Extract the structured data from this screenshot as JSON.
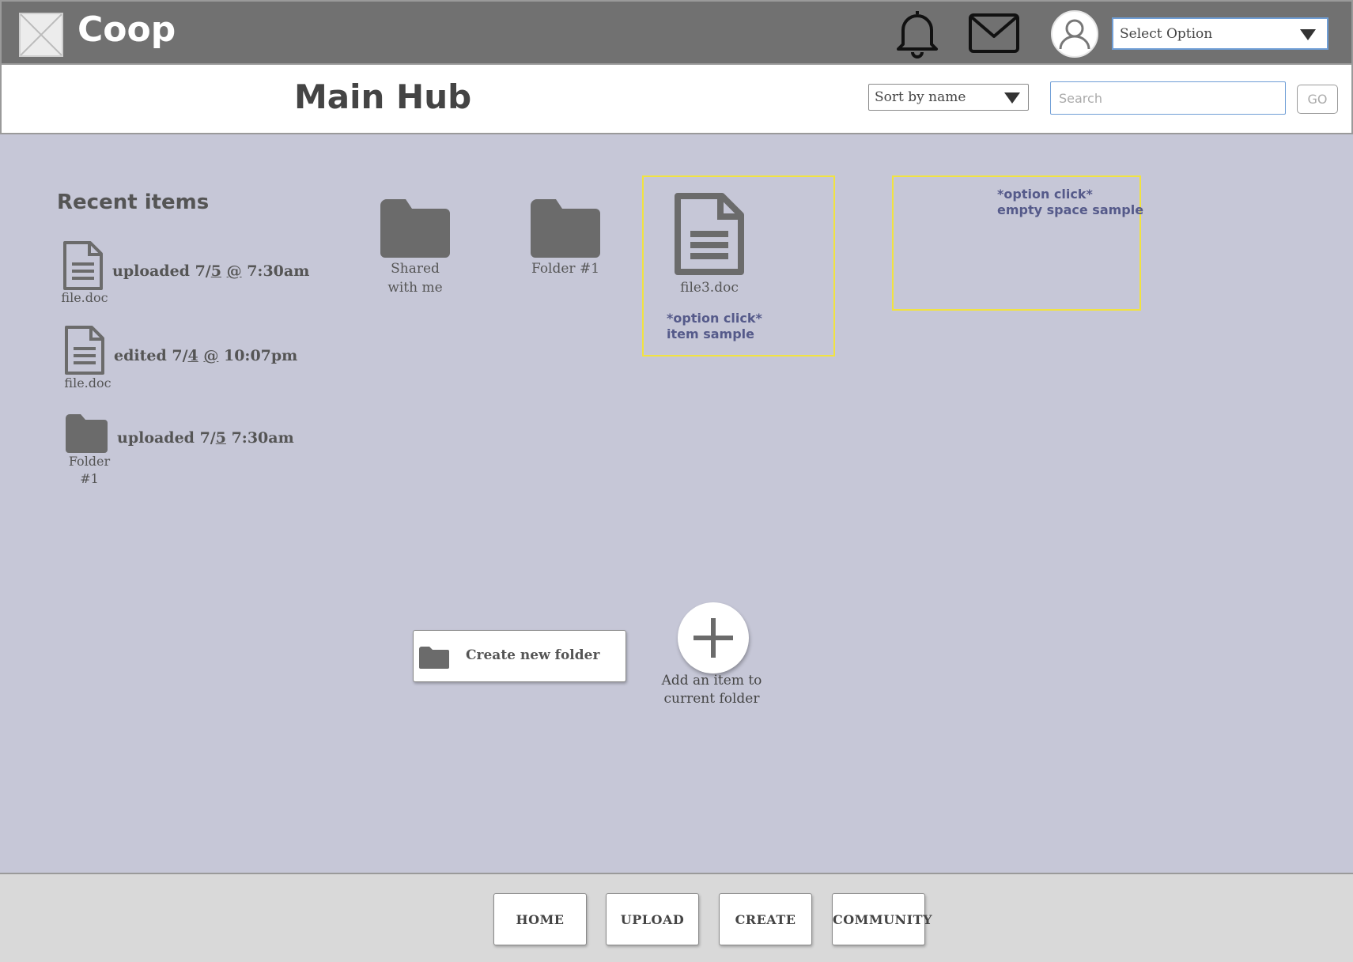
{
  "header": {
    "app_title": "Coop",
    "select_option": "Select Option"
  },
  "subheader": {
    "page_title": "Main Hub",
    "sort_select": "Sort by name",
    "search_placeholder": "Search",
    "go_label": "GO"
  },
  "recent": {
    "title": "Recent items",
    "items": [
      {
        "icon": "document-icon",
        "name": "file.doc",
        "meta_pre": "uploaded 7/",
        "meta_u": "5",
        "meta_mid": " ",
        "meta_u2": "@",
        "meta_post": " 7:30am"
      },
      {
        "icon": "document-icon",
        "name": "file.doc",
        "meta_pre": "edited 7/",
        "meta_u": "4",
        "meta_mid": " ",
        "meta_u2": "@",
        "meta_post": " 10:07pm"
      },
      {
        "icon": "folder-icon",
        "name": "Folder #1",
        "meta_pre": "uploaded 7/",
        "meta_u": "5",
        "meta_mid": " 7:30am",
        "meta_u2": "",
        "meta_post": ""
      }
    ]
  },
  "grid": {
    "shared": "Shared with me",
    "folder1": "Folder #1",
    "file3": "file3.doc"
  },
  "samples": {
    "item_note": "*option click*\nitem sample",
    "empty_note": "*option click*\nempty space sample"
  },
  "actions": {
    "create_folder": "Create new folder",
    "add_item": "Add an item to current folder"
  },
  "bottom_nav": [
    "HOME",
    "UPLOAD",
    "CREATE",
    "COMMUNITY"
  ],
  "colors": {
    "topbar": "#717171",
    "background": "#c6c7d7",
    "icon_gray": "#6b6b6b",
    "sample_border": "#f1e340"
  }
}
